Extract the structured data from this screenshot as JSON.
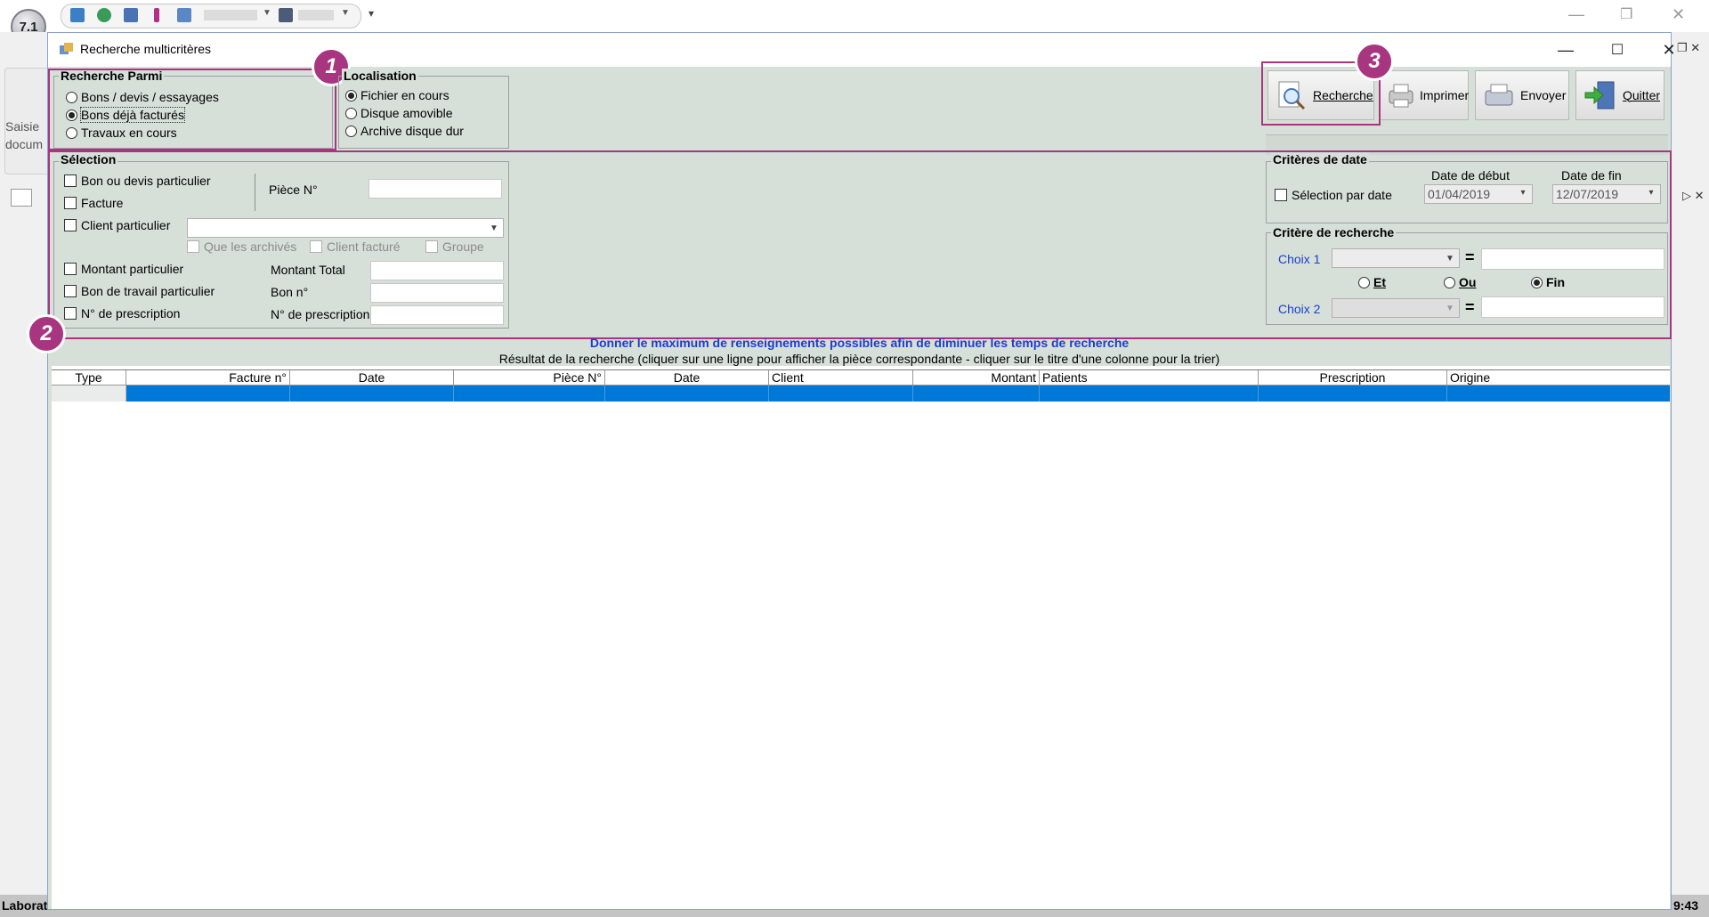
{
  "background_app": {
    "logo_text": "7.1",
    "left_tab_text": "Saisie docum",
    "status_left": "Laborat",
    "status_right": "9:43"
  },
  "dialog": {
    "title": "Recherche multicritères",
    "recherche_parmi": {
      "legend": "Recherche Parmi",
      "options": [
        {
          "label": "Bons / devis / essayages",
          "selected": false
        },
        {
          "label": "Bons déjà facturés",
          "selected": true
        },
        {
          "label": "Travaux  en cours",
          "selected": false
        }
      ]
    },
    "localisation": {
      "legend": "Localisation",
      "options": [
        {
          "label": "Fichier en cours",
          "selected": true
        },
        {
          "label": "Disque amovible",
          "selected": false
        },
        {
          "label": "Archive disque dur",
          "selected": false
        }
      ]
    },
    "toolbar": {
      "recherche_label": "Recherche",
      "imprimer_label": "Imprimer",
      "envoyer_label": "Envoyer",
      "quitter_label": "Quitter"
    },
    "selection": {
      "legend": "Sélection",
      "bon_ou_devis": "Bon ou devis particulier",
      "facture": "Facture",
      "piece_label": "Pièce N°",
      "client_particulier": "Client particulier",
      "que_les_archives": "Que les archivés",
      "client_facture": "Client facturé",
      "groupe": "Groupe",
      "montant_particulier": "Montant particulier",
      "montant_total_label": "Montant Total",
      "bon_de_travail": "Bon de travail particulier",
      "bon_n_label": "Bon n°",
      "n_prescription_check": "N° de prescription",
      "n_prescription_label": "N° de prescription"
    },
    "criteres_date": {
      "legend": "Critères de date",
      "selection_par_date": "Sélection par date",
      "date_debut_label": "Date de début",
      "date_debut": "01/04/2019",
      "date_fin_label": "Date de fin",
      "date_fin": "12/07/2019"
    },
    "critere_recherche": {
      "legend": "Critère de recherche",
      "choix1": "Choix 1",
      "choix2": "Choix 2",
      "equals": "=",
      "et": "Et",
      "ou": "Ou",
      "fin": "Fin"
    },
    "hint": "Donner le maximum de renseignements possibles afin de diminuer les temps de recherche",
    "result_caption": "Résultat de la recherche (cliquer sur une ligne pour afficher la pièce correspondante - cliquer sur le titre d'une colonne pour la trier)",
    "columns": [
      "Type",
      "Facture n°",
      "Date",
      "Pièce N°",
      "Date",
      "Client",
      "Montant",
      "Patients",
      "Prescription",
      "Origine"
    ],
    "badges": [
      "1",
      "2",
      "3"
    ]
  },
  "colors": {
    "dialog_bg": "#d6dfd8",
    "highlight": "#a8357f",
    "selected_row": "#0078d7",
    "hint_text": "#1a3fcf"
  }
}
